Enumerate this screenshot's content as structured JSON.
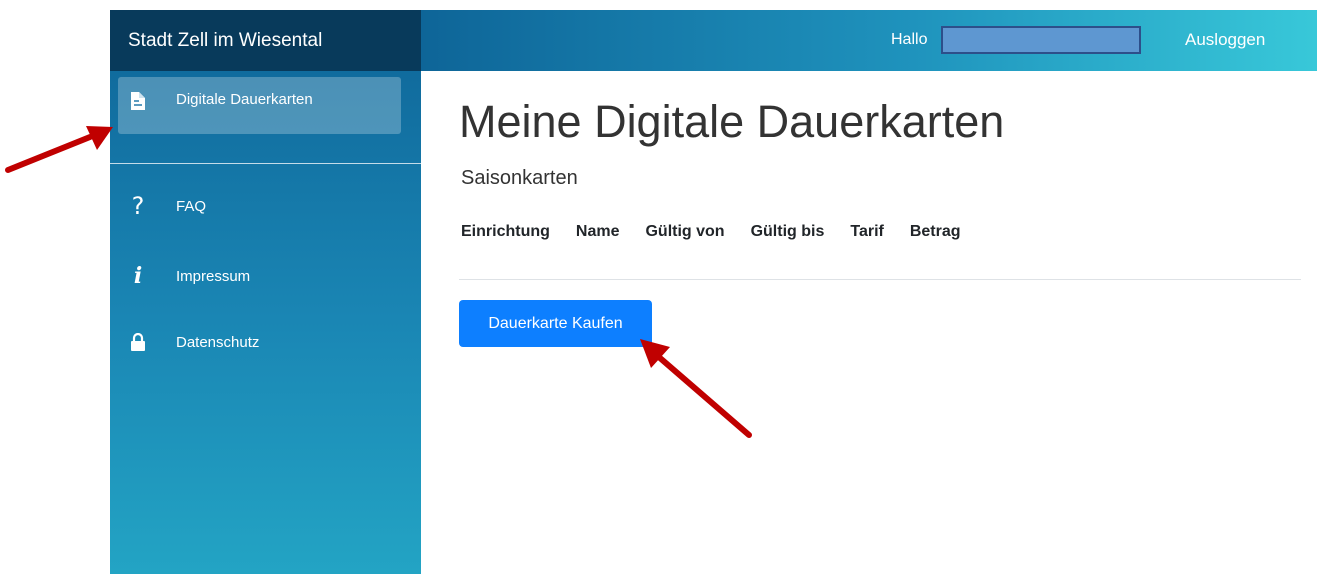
{
  "sidebar": {
    "brand": "Stadt Zell im Wiesental",
    "items": [
      {
        "label": "Digitale Dauerkarten",
        "icon": "document-icon",
        "active": true
      },
      {
        "label": "FAQ",
        "icon": "question-icon"
      },
      {
        "label": "Impressum",
        "icon": "info-icon"
      },
      {
        "label": "Datenschutz",
        "icon": "lock-icon"
      }
    ]
  },
  "header": {
    "greeting": "Hallo",
    "logout_label": "Ausloggen"
  },
  "main": {
    "title": "Meine Digitale Dauerkarten",
    "subtitle": "Saisonkarten",
    "table_headers": [
      "Einrichtung",
      "Name",
      "Gültig von",
      "Gültig bis",
      "Tarif",
      "Betrag"
    ],
    "buy_button_label": "Dauerkarte Kaufen"
  },
  "colors": {
    "brand_bg": "#083a5b",
    "button": "#0d7fff",
    "annotation_arrow": "#c00000"
  }
}
